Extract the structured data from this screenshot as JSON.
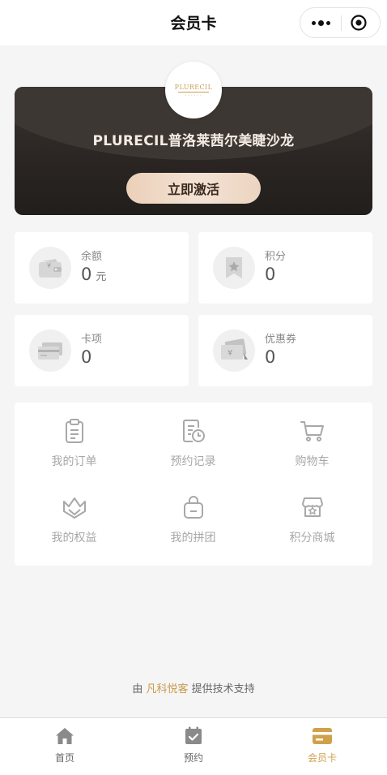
{
  "header": {
    "title": "会员卡"
  },
  "card": {
    "logo_text": "PLURECIL",
    "brand_name": "PLURECIL普洛莱茜尔美睫沙龙",
    "activate_label": "立即激活"
  },
  "stats": {
    "balance": {
      "label": "余额",
      "value": "0",
      "unit": "元",
      "icon": "wallet-icon"
    },
    "points": {
      "label": "积分",
      "value": "0",
      "icon": "points-icon"
    },
    "cards": {
      "label": "卡项",
      "value": "0",
      "icon": "card-icon"
    },
    "coupons": {
      "label": "优惠券",
      "value": "0",
      "icon": "coupon-icon"
    }
  },
  "menu": {
    "items": [
      {
        "label": "我的订单",
        "icon": "clipboard-icon"
      },
      {
        "label": "预约记录",
        "icon": "schedule-record-icon"
      },
      {
        "label": "购物车",
        "icon": "cart-icon"
      },
      {
        "label": "我的权益",
        "icon": "crown-icon"
      },
      {
        "label": "我的拼团",
        "icon": "bag-icon"
      },
      {
        "label": "积分商城",
        "icon": "shop-icon"
      }
    ]
  },
  "credit": {
    "prefix": "由",
    "company": "凡科悦客",
    "suffix": "提供技术支持"
  },
  "tabbar": {
    "tabs": [
      {
        "label": "首页",
        "icon": "home-icon",
        "active": false
      },
      {
        "label": "预约",
        "icon": "calendar-check-icon",
        "active": false
      },
      {
        "label": "会员卡",
        "icon": "member-card-icon",
        "active": true
      }
    ]
  },
  "colors": {
    "accent": "#d0a14b",
    "card_dark": "#2b2623",
    "button_light": "#f0dccb"
  }
}
